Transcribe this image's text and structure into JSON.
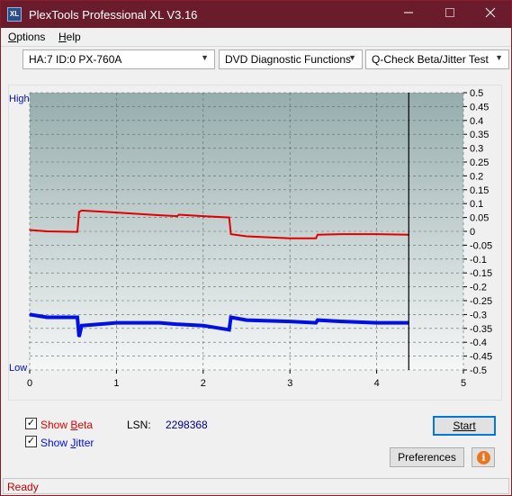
{
  "window": {
    "title": "PlexTools Professional XL V3.16",
    "icon_text": "XL",
    "minimize_icon": "minimize-icon",
    "maximize_icon": "maximize-icon",
    "close_icon": "close-icon"
  },
  "menu": {
    "items": [
      {
        "label_u": "O",
        "label_rest": "ptions"
      },
      {
        "label_u": "H",
        "label_rest": "elp"
      }
    ]
  },
  "toolbar": {
    "drive": "HA:7 ID:0  PX-760A",
    "function": "DVD Diagnostic Functions",
    "test": "Q-Check Beta/Jitter Test"
  },
  "chart_labels": {
    "high": "High",
    "low": "Low"
  },
  "chart_data": {
    "type": "line",
    "x": [
      0,
      0.2,
      0.55,
      0.57,
      0.6,
      1.0,
      1.5,
      1.7,
      1.72,
      2.0,
      2.3,
      2.32,
      2.5,
      3.0,
      3.3,
      3.32,
      3.6,
      4.0,
      4.37
    ],
    "xlim": [
      0,
      5
    ],
    "ylim": [
      -0.5,
      0.5
    ],
    "x_ticks": [
      "0",
      "1",
      "2",
      "3",
      "4",
      "5"
    ],
    "y_ticks": [
      "0.5",
      "0.45",
      "0.4",
      "0.35",
      "0.3",
      "0.25",
      "0.2",
      "0.15",
      "0.1",
      "0.05",
      "0",
      "-0.05",
      "-0.1",
      "-0.15",
      "-0.2",
      "-0.25",
      "-0.3",
      "-0.35",
      "-0.4",
      "-0.45",
      "-0.5"
    ],
    "marker_x": 4.37,
    "grid": true,
    "series": [
      {
        "name": "Beta",
        "color": "#e00000",
        "values": [
          0.005,
          0.0,
          -0.002,
          0.07,
          0.075,
          0.068,
          0.058,
          0.055,
          0.06,
          0.055,
          0.05,
          -0.01,
          -0.018,
          -0.025,
          -0.025,
          -0.012,
          -0.01,
          -0.01,
          -0.012
        ]
      },
      {
        "name": "Jitter",
        "color": "#0010e0",
        "values": [
          -0.3,
          -0.31,
          -0.31,
          -0.38,
          -0.34,
          -0.33,
          -0.33,
          -0.335,
          -0.335,
          -0.34,
          -0.355,
          -0.31,
          -0.32,
          -0.325,
          -0.33,
          -0.32,
          -0.325,
          -0.33,
          -0.33
        ]
      }
    ]
  },
  "controls": {
    "show_beta_u": "B",
    "show_beta_pre": "Show ",
    "show_beta_post": "eta",
    "show_jitter_pre": "Show ",
    "show_jitter_u": "J",
    "show_jitter_post": "itter",
    "lsn_label": "LSN:",
    "lsn_value": "2298368",
    "start_label": "Start",
    "preferences_label": "Preferences",
    "info_glyph": "i"
  },
  "status": {
    "text": "Ready"
  }
}
